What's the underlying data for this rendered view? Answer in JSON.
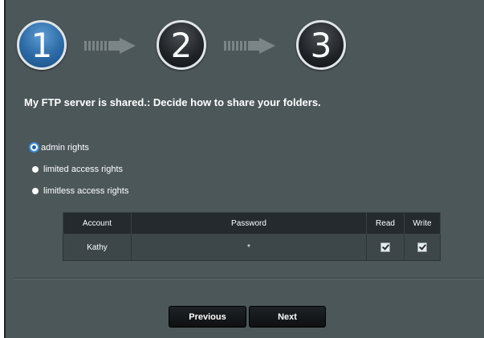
{
  "steps": [
    {
      "number": "1",
      "state": "active"
    },
    {
      "number": "2",
      "state": "inactive"
    },
    {
      "number": "3",
      "state": "inactive"
    }
  ],
  "heading": "My FTP server is shared.: Decide how to share your folders.",
  "options": [
    {
      "label": "admin rights",
      "selected": true
    },
    {
      "label": "limited access rights",
      "selected": false
    },
    {
      "label": "limitless access rights",
      "selected": false
    }
  ],
  "table": {
    "headers": {
      "account": "Account",
      "password": "Password",
      "read": "Read",
      "write": "Write"
    },
    "rows": [
      {
        "account": "Kathy",
        "password": "*",
        "read": true,
        "write": true
      }
    ]
  },
  "buttons": {
    "previous": "Previous",
    "next": "Next"
  },
  "colors": {
    "accent": "#2c6aa6",
    "panel": "#4c5759"
  }
}
